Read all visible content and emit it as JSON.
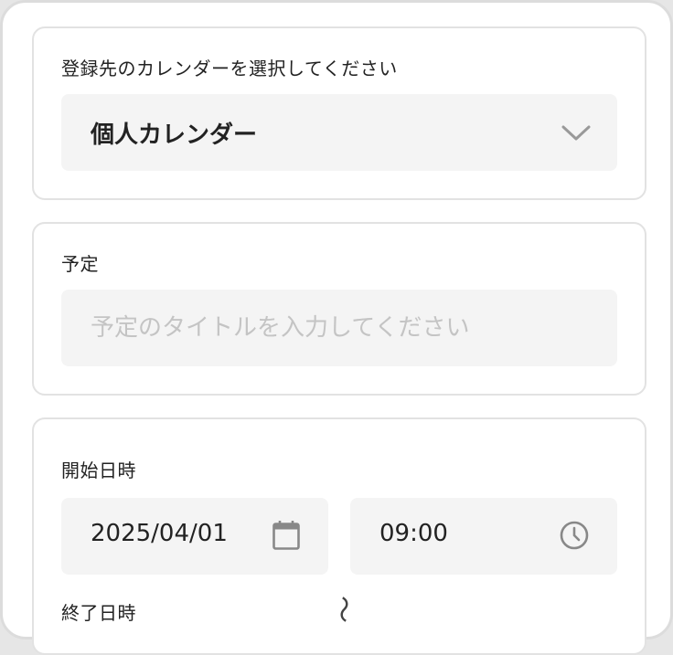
{
  "calendar_section": {
    "label": "登録先のカレンダーを選択してください",
    "selected": "個人カレンダー",
    "icon": "chevron-down-icon"
  },
  "event_section": {
    "label": "予定",
    "placeholder": "予定のタイトルを入力してください",
    "value": ""
  },
  "start_section": {
    "label": "開始日時",
    "date": "2025/04/01",
    "time": "09:00",
    "date_icon": "calendar-icon",
    "time_icon": "clock-icon"
  },
  "range_separator": "〜",
  "end_section": {
    "label": "終了日時"
  },
  "colors": {
    "field_bg": "#f4f4f4",
    "border": "#e2e2e2",
    "placeholder": "#c4c4c4",
    "icon": "#888888"
  }
}
